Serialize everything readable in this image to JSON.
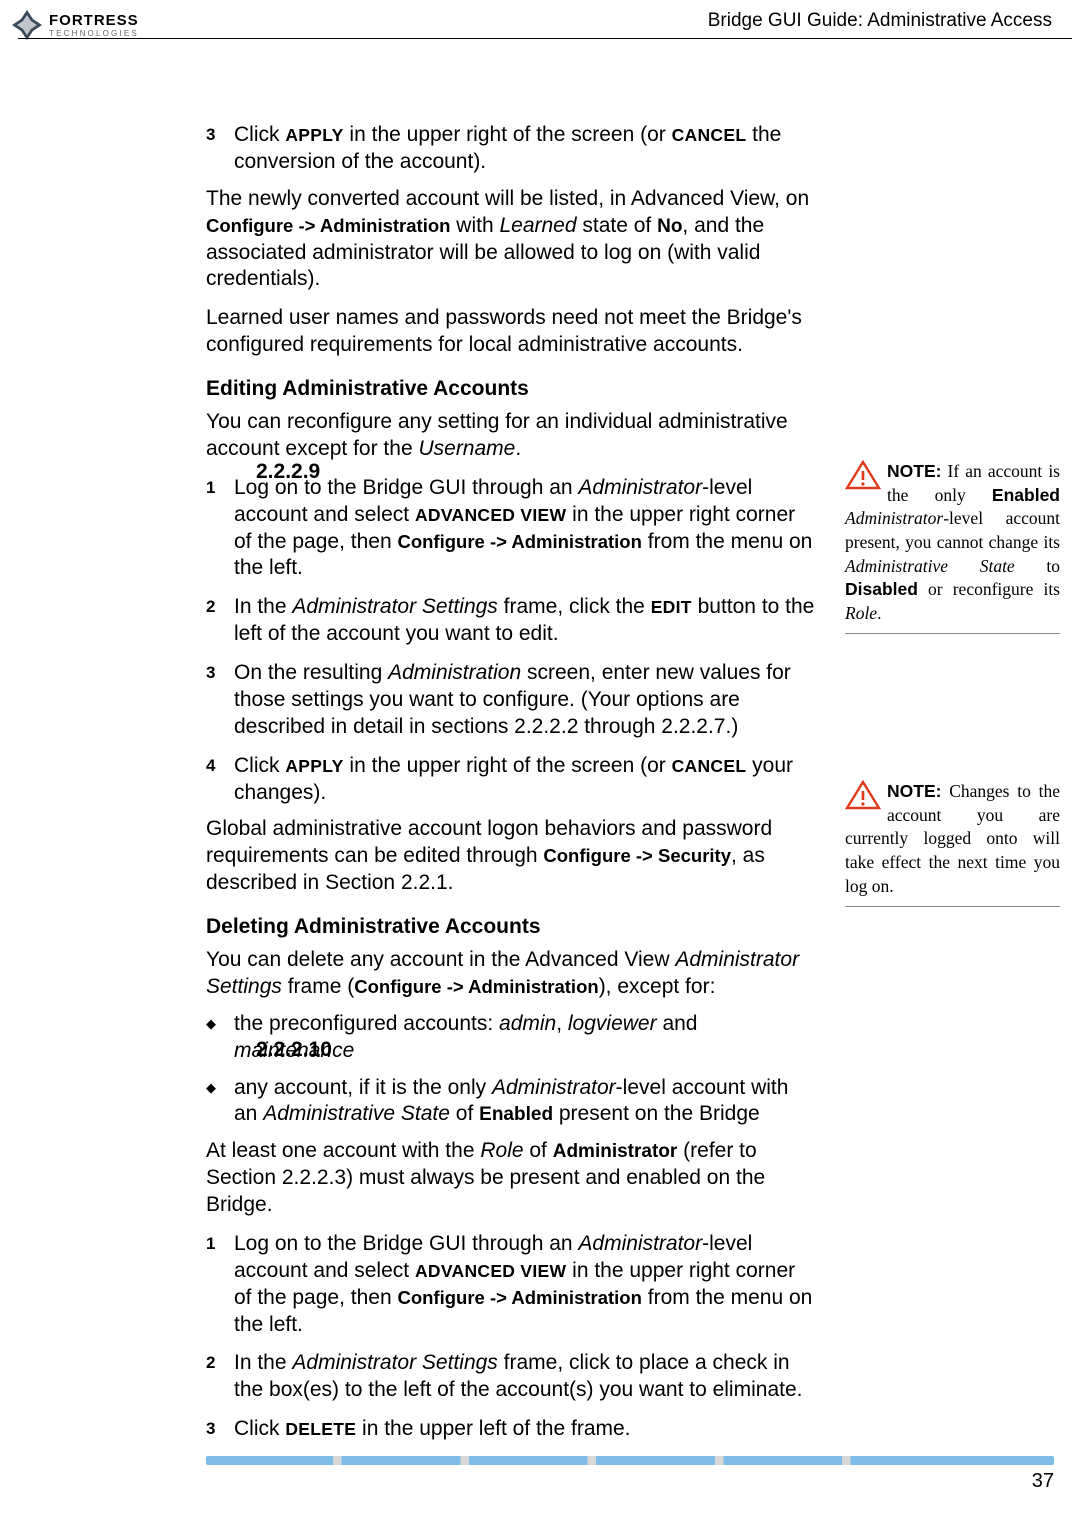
{
  "logo": {
    "name": "FORTRESS",
    "sub": "TECHNOLOGIES"
  },
  "header": "Bridge GUI Guide: Administrative Access",
  "page_number": "37",
  "section_229": {
    "num": "2.2.2.9",
    "title": "Editing Administrative Accounts"
  },
  "section_2210": {
    "num": "2.2.2.10",
    "title": "Deleting Administrative Accounts"
  },
  "top_step3_a": "Click ",
  "top_step3_b": " in the upper right of the screen (or ",
  "top_step3_c": " the conversion of the account).",
  "apply": "APPLY",
  "cancel": "CANCEL",
  "top_p1_a": "The newly converted account will be listed, in Advanced View, on ",
  "top_p1_menu": "Configure -> Administration",
  "top_p1_b": " with ",
  "top_p1_learned": "Learned",
  "top_p1_c": " state of ",
  "top_p1_no": "No",
  "top_p1_d": ", and the associated administrator will be allowed to log on (with valid credentials).",
  "top_p2": "Learned user names and passwords need not meet the Bridge's configured requirements for local administrative accounts.",
  "s229_intro_a": "You can reconfigure any setting for an individual administrative account except for the ",
  "s229_intro_user": "Username",
  "s229_intro_b": ".",
  "s229_step1_a": "Log on to the Bridge GUI through an ",
  "s229_step1_admin": "Administrator",
  "s229_step1_b": "-level account and select ",
  "s229_step1_adv": "ADVANCED VIEW",
  "s229_step1_c": " in the upper right corner of the page, then ",
  "s229_step1_menu": "Configure -> Administration",
  "s229_step1_d": " from the menu on the left.",
  "s229_step2_a": "In the ",
  "s229_step2_as": "Administrator Settings",
  "s229_step2_b": " frame, click the ",
  "s229_step2_edit": "EDIT",
  "s229_step2_c": " button to the left of the account you want to edit.",
  "s229_step3_a": "On the resulting ",
  "s229_step3_admin": "Administration",
  "s229_step3_b": " screen, enter new values for those settings you want to configure. (Your options are described in detail in sections 2.2.2.2 through 2.2.2.7.)",
  "s229_step4_a": "Click ",
  "s229_step4_b": " in the upper right of the screen (or ",
  "s229_step4_c": " your changes).",
  "s229_p2_a": "Global administrative account logon behaviors and password requirements can be edited through ",
  "s229_p2_menu": "Configure -> Security",
  "s229_p2_b": ", as described in Section 2.2.1.",
  "s2210_intro_a": "You can delete any account in the Advanced View ",
  "s2210_intro_as": "Administrator Settings",
  "s2210_intro_b": " frame (",
  "s2210_intro_menu": "Configure -> Administration",
  "s2210_intro_c": "), except for:",
  "s2210_b1_a": "the preconfigured accounts: ",
  "s2210_b1_admin": "admin",
  "s2210_b1_b": ", ",
  "s2210_b1_log": "logviewer",
  "s2210_b1_c": " and ",
  "s2210_b1_maint": "maintenance",
  "s2210_b2_a": "any account, if it is the only ",
  "s2210_b2_admin": "Administrator",
  "s2210_b2_b": "-level account with an ",
  "s2210_b2_as": "Administrative State",
  "s2210_b2_c": " of ",
  "s2210_b2_en": "Enabled",
  "s2210_b2_d": " present on the Bridge",
  "s2210_p2_a": "At least one account with the ",
  "s2210_p2_role": "Role",
  "s2210_p2_b": " of ",
  "s2210_p2_admin": "Administrator",
  "s2210_p2_c": " (refer to Section 2.2.2.3) must always be present and enabled on the Bridge.",
  "s2210_step1_a": "Log on to the Bridge GUI through an ",
  "s2210_step1_admin": "Administrator",
  "s2210_step1_b": "-level account and select ",
  "s2210_step1_adv": "ADVANCED VIEW",
  "s2210_step1_c": " in the upper right corner of the page, then ",
  "s2210_step1_menu": "Configure -> Administration",
  "s2210_step1_d": " from the menu on the left.",
  "s2210_step2_a": "In the ",
  "s2210_step2_as": "Administrator Settings",
  "s2210_step2_b": " frame, click to place a check in the box(es) to the left of the account(s) you want to eliminate.",
  "s2210_step3_a": "Click ",
  "s2210_step3_del": "DELETE",
  "s2210_step3_b": " in the upper left of the frame.",
  "note1": {
    "head": "NOTE:",
    "a": " If an account is the only ",
    "enabled": "Enabled",
    "b": " ",
    "adminit": "Administrator",
    "c": "-level account present, you cannot change its ",
    "asit": "Administrative State",
    "d": " to ",
    "disabled": "Disabled",
    "e": " or reconfigure its ",
    "role": "Role",
    "f": "."
  },
  "note2": {
    "head": "NOTE:",
    "a": " Changes to the account you are currently logged onto will take effect the next time you log on."
  }
}
